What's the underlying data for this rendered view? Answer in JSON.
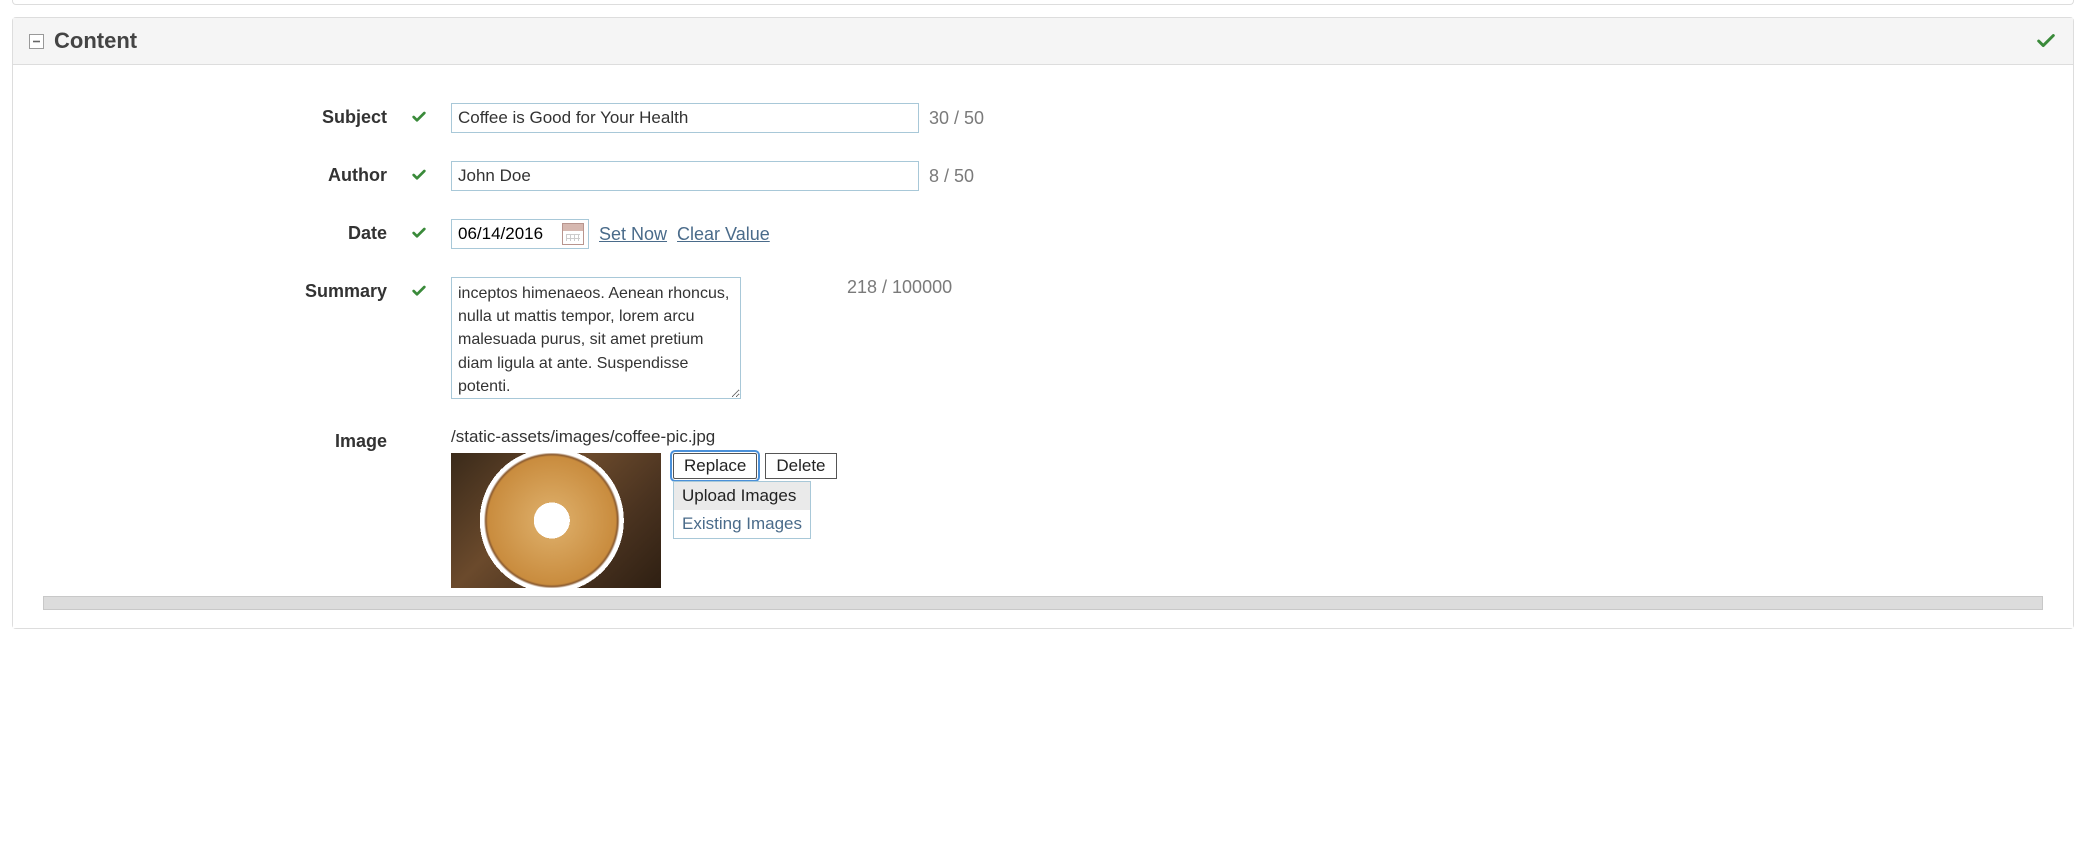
{
  "panel": {
    "title": "Content"
  },
  "fields": {
    "subject": {
      "label": "Subject",
      "value": "Coffee is Good for Your Health",
      "counter": "30 / 50"
    },
    "author": {
      "label": "Author",
      "value": "John Doe",
      "counter": "8 / 50"
    },
    "date": {
      "label": "Date",
      "value": "06/14/2016",
      "setNow": "Set Now",
      "clearValue": "Clear Value"
    },
    "summary": {
      "label": "Summary",
      "value": "inceptos himenaeos. Aenean rhoncus, nulla ut mattis tempor, lorem arcu malesuada purus, sit amet pretium diam ligula at ante. Suspendisse potenti.",
      "counter": "218 / 100000"
    },
    "image": {
      "label": "Image",
      "path": "/static-assets/images/coffee-pic.jpg",
      "replace": "Replace",
      "delete": "Delete",
      "menu": {
        "upload": "Upload Images",
        "existing": "Existing Images"
      }
    }
  }
}
